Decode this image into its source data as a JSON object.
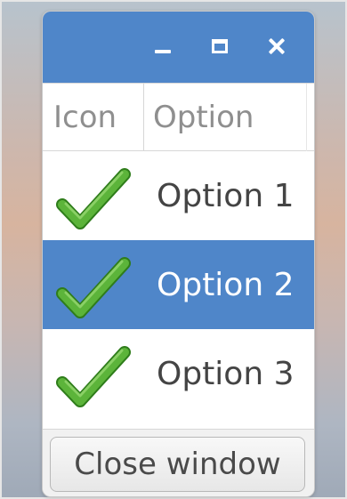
{
  "window": {
    "titlebar_color": "#4f86c9",
    "controls": {
      "minimize_icon": "minimize-icon",
      "maximize_icon": "maximize-icon",
      "close_icon": "close-icon"
    }
  },
  "table": {
    "columns": [
      {
        "label": "Icon"
      },
      {
        "label": "Option"
      }
    ],
    "rows": [
      {
        "icon": "checkmark-icon",
        "label": "Option 1",
        "selected": false
      },
      {
        "icon": "checkmark-icon",
        "label": "Option 2",
        "selected": true
      },
      {
        "icon": "checkmark-icon",
        "label": "Option 3",
        "selected": false
      }
    ],
    "selection_color": "#4f86c9"
  },
  "footer": {
    "close_button_label": "Close window"
  }
}
